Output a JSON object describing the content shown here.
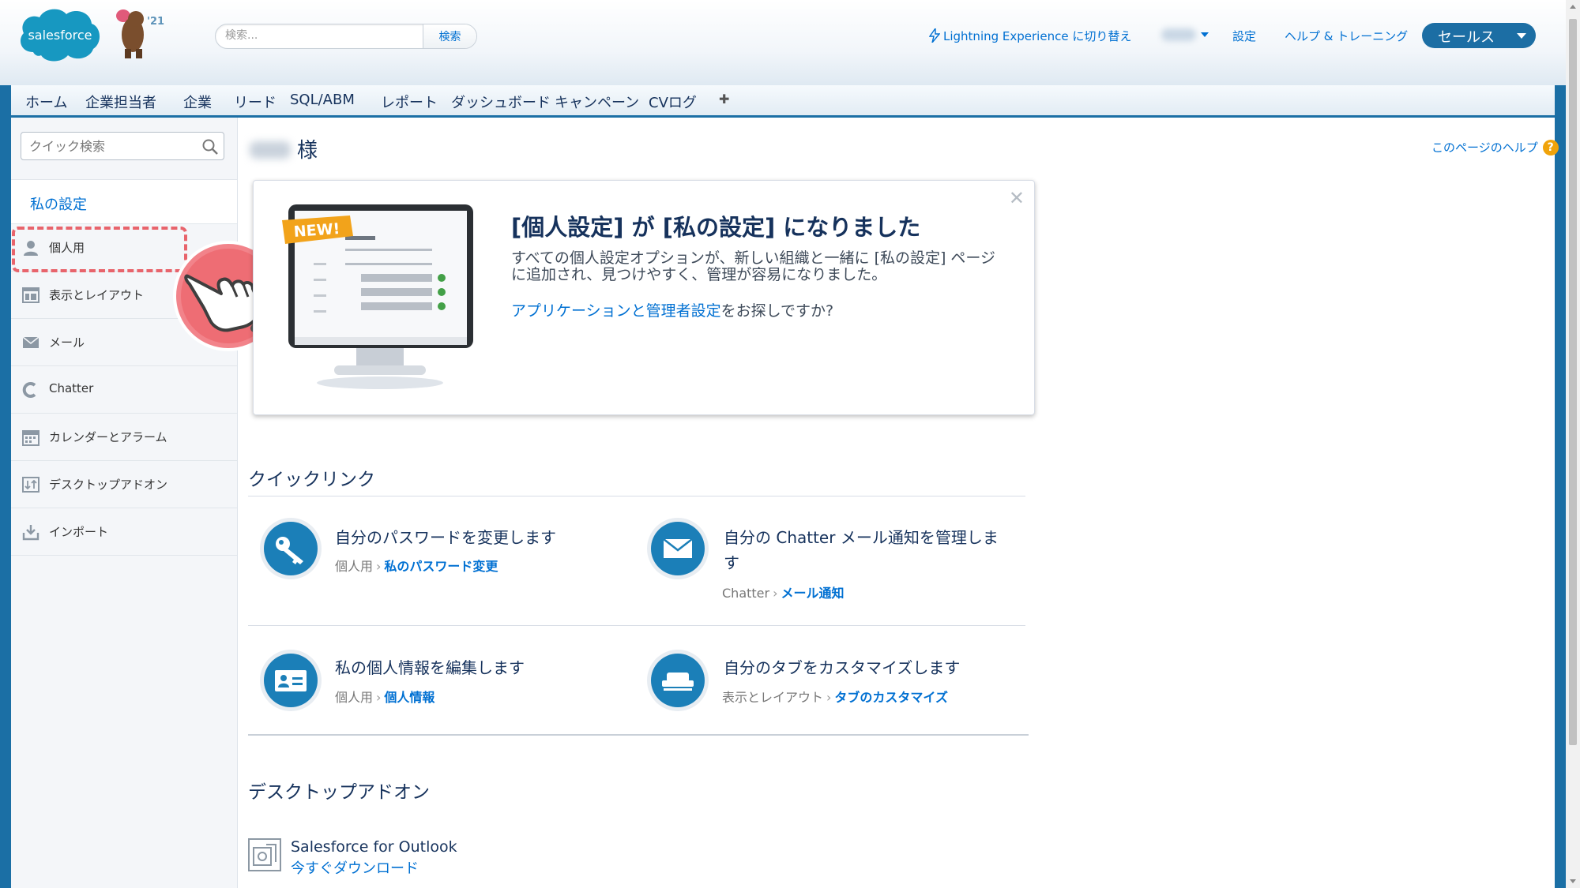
{
  "header": {
    "logo_text": "salesforce",
    "release_badge": "'21",
    "search_placeholder": "検索...",
    "search_button": "検索",
    "lightning_link": "Lightning Experience に切り替え",
    "setup_link": "設定",
    "help_link": "ヘルプ & トレーニング",
    "app_switcher": "セールス"
  },
  "tabs": [
    "ホーム",
    "企業担当者",
    "企業",
    "リード",
    "SQL/ABM",
    "レポート",
    "ダッシュボード",
    "キャンペーン",
    "CVログ",
    "✚"
  ],
  "sidebar": {
    "quick_find_placeholder": "クイック検索",
    "heading": "私の設定",
    "items": [
      {
        "label": "個人用",
        "icon": "person-icon"
      },
      {
        "label": "表示とレイアウト",
        "icon": "layout-icon"
      },
      {
        "label": "メール",
        "icon": "envelope-icon"
      },
      {
        "label": "Chatter",
        "icon": "chatter-icon"
      },
      {
        "label": "カレンダーとアラーム",
        "icon": "calendar-icon"
      },
      {
        "label": "デスクトップアドオン",
        "icon": "desktop-addon-icon"
      },
      {
        "label": "インポート",
        "icon": "import-icon"
      }
    ]
  },
  "page": {
    "title_suffix": "様",
    "help_link": "このページのヘルプ",
    "help_icon": "?"
  },
  "banner": {
    "new_badge": "NEW!",
    "title": "[個人設定] が [私の設定] になりました",
    "body": "すべての個人設定オプションが、新しい組織と一緒に [私の設定] ページに追加され、見つけやすく、管理が容易になりました。",
    "link_text": "アプリケーションと管理者設定",
    "link_suffix": "をお探しですか?"
  },
  "quick_links": {
    "heading": "クイックリンク",
    "items": [
      {
        "title": "自分のパスワードを変更します",
        "crumb_parent": "個人用",
        "crumb_link": "私のパスワード変更",
        "icon": "key-icon"
      },
      {
        "title": "自分の Chatter メール通知を管理します",
        "crumb_parent": "Chatter",
        "crumb_link": "メール通知",
        "icon": "envelope-icon"
      },
      {
        "title": "私の個人情報を編集します",
        "crumb_parent": "個人用",
        "crumb_link": "個人情報",
        "icon": "id-card-icon"
      },
      {
        "title": "自分のタブをカスタマイズします",
        "crumb_parent": "表示とレイアウト",
        "crumb_link": "タブのカスタマイズ",
        "icon": "tabs-icon"
      }
    ]
  },
  "desktop_addons": {
    "heading": "デスクトップアドオン",
    "item_title": "Salesforce for Outlook",
    "item_link": "今すぐダウンロード"
  },
  "colors": {
    "brand_blue": "#1b6fa5",
    "link_blue": "#0070d2",
    "highlight": "#e8646c",
    "icon_circle": "#1b7fb8"
  }
}
